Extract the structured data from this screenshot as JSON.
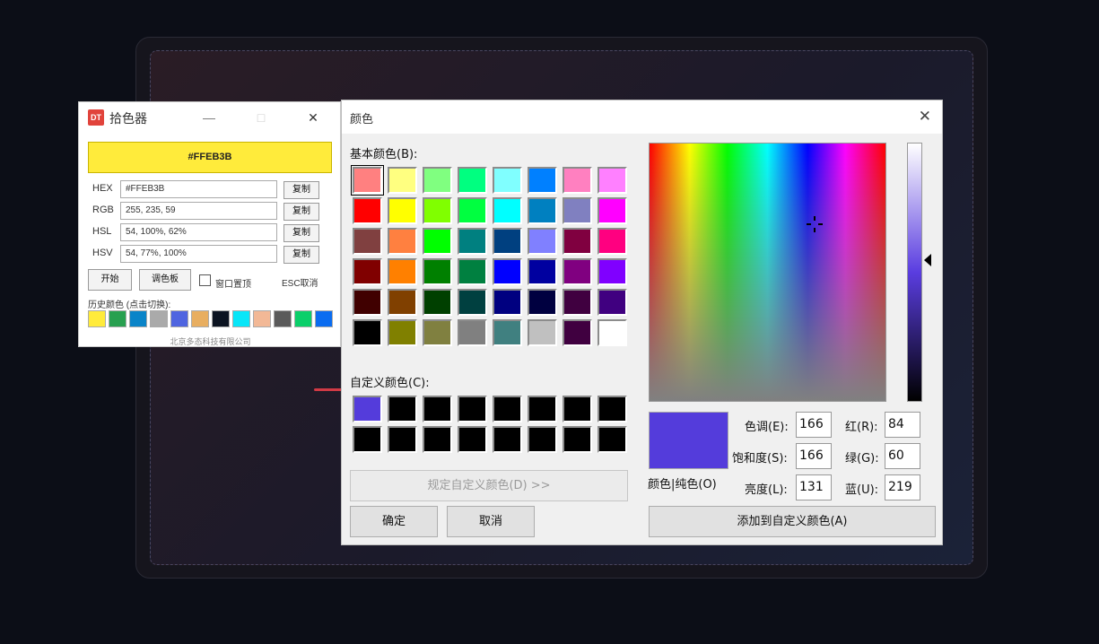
{
  "picker": {
    "logo": "DT",
    "title": "拾色器",
    "minimize": "—",
    "maximize": "□",
    "close": "✕",
    "preview_hex": "#FFEB3B",
    "preview_color": "#FFEB3B",
    "rows": [
      {
        "label": "HEX",
        "value": "#FFEB3B",
        "button": "复制"
      },
      {
        "label": "RGB",
        "value": "255, 235, 59",
        "button": "复制"
      },
      {
        "label": "HSL",
        "value": "54, 100%, 62%",
        "button": "复制"
      },
      {
        "label": "HSV",
        "value": "54, 77%, 100%",
        "button": "复制"
      }
    ],
    "start_button": "开始",
    "palette_button": "调色板",
    "always_on_top": "窗口置顶",
    "esc_hint": "ESC取消",
    "history_label": "历史颜色 (点击切换):",
    "history_colors": [
      "#FFEB3B",
      "#28A050",
      "#0A84C8",
      "#AAAAAA",
      "#4F65E0",
      "#E8AE60",
      "#0C1422",
      "#08E6F8",
      "#F2B896",
      "#5A5A5A",
      "#0ACF6A",
      "#0A6CF0"
    ],
    "company": "北京多态科技有限公司"
  },
  "dialog": {
    "title": "颜色",
    "close": "✕",
    "basic_label": "基本颜色(B):",
    "basic_colors": [
      "#FF8080",
      "#FFFF80",
      "#80FF80",
      "#00FF80",
      "#80FFFF",
      "#0080FF",
      "#FF80C0",
      "#FF80FF",
      "#FF0000",
      "#FFFF00",
      "#80FF00",
      "#00FF40",
      "#00FFFF",
      "#0080C0",
      "#8080C0",
      "#FF00FF",
      "#804040",
      "#FF8040",
      "#00FF00",
      "#008080",
      "#004080",
      "#8080FF",
      "#800040",
      "#FF0080",
      "#800000",
      "#FF8000",
      "#008000",
      "#008040",
      "#0000FF",
      "#0000A0",
      "#800080",
      "#8000FF",
      "#400000",
      "#804000",
      "#004000",
      "#004040",
      "#000080",
      "#000040",
      "#400040",
      "#400080",
      "#000000",
      "#808000",
      "#808040",
      "#808080",
      "#408080",
      "#C0C0C0",
      "#400040",
      "#FFFFFF"
    ],
    "custom_label": "自定义颜色(C):",
    "custom_colors": [
      "#543CDB",
      "#000000",
      "#000000",
      "#000000",
      "#000000",
      "#000000",
      "#000000",
      "#000000",
      "#000000",
      "#000000",
      "#000000",
      "#000000",
      "#000000",
      "#000000",
      "#000000",
      "#000000"
    ],
    "define_custom_button": "规定自定义颜色(D) >>",
    "ok_button": "确定",
    "cancel_button": "取消",
    "current_color": "#543CDB",
    "solid_label": "颜色|纯色(O)",
    "hue_label": "色调(E):",
    "hue": "166",
    "sat_label": "饱和度(S):",
    "sat": "166",
    "lum_label": "亮度(L):",
    "lum": "131",
    "red_label": "红(R):",
    "red": "84",
    "green_label": "绿(G):",
    "green": "60",
    "blue_label": "蓝(U):",
    "blue": "219",
    "add_custom_button": "添加到自定义颜色(A)"
  }
}
